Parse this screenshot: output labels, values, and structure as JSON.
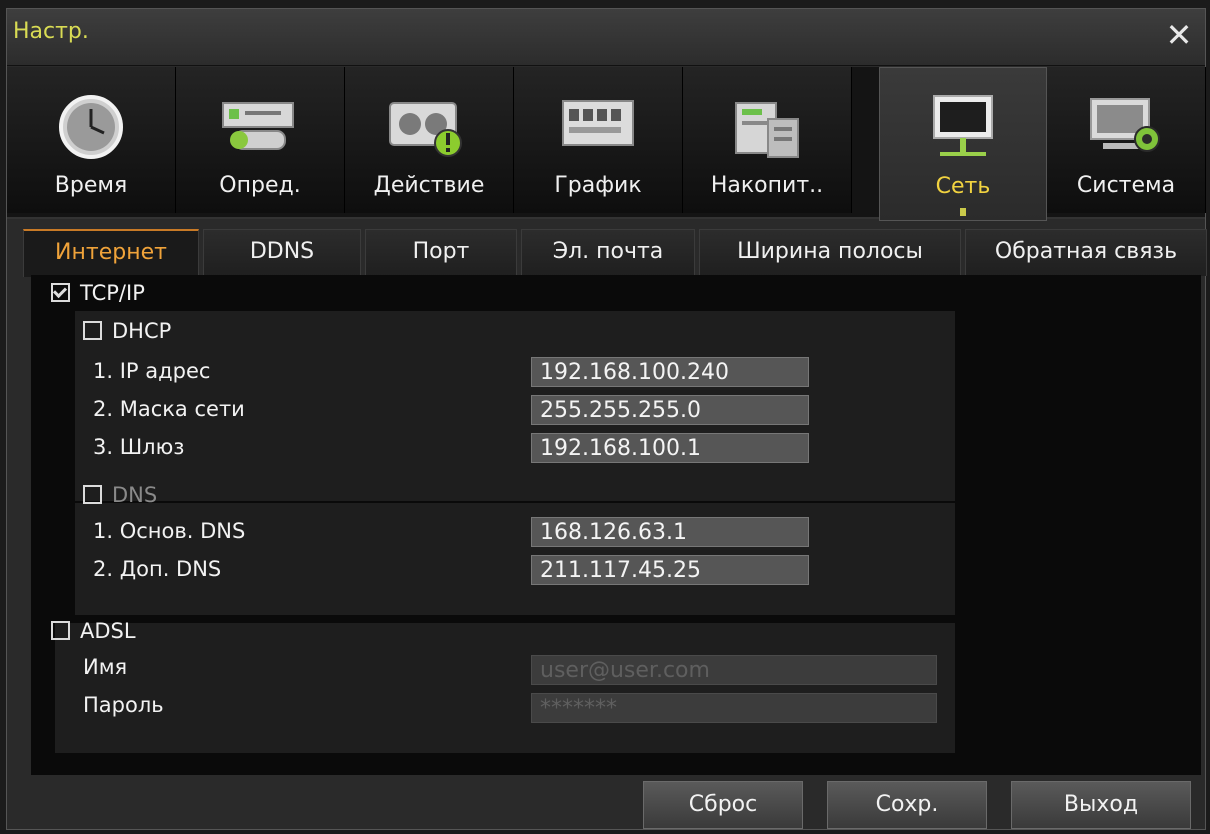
{
  "window": {
    "title": "Настр."
  },
  "toolbar": {
    "items": [
      {
        "label": "Время"
      },
      {
        "label": "Опред."
      },
      {
        "label": "Действие"
      },
      {
        "label": "График"
      },
      {
        "label": "Накопит.."
      },
      {
        "label": "Сеть"
      },
      {
        "label": "Система"
      }
    ],
    "active": "Сеть"
  },
  "tabs": [
    {
      "label": "Интернет"
    },
    {
      "label": "DDNS"
    },
    {
      "label": "Порт"
    },
    {
      "label": "Эл. почта"
    },
    {
      "label": "Ширина полосы"
    },
    {
      "label": "Обратная связь"
    }
  ],
  "form": {
    "tcpip": {
      "label": "TCP/IP",
      "checked": true
    },
    "dhcp": {
      "label": "DHCP",
      "checked": false
    },
    "ip": {
      "label": "1. IP адрес",
      "value": "192.168.100.240"
    },
    "mask": {
      "label": "2. Маска сети",
      "value": "255.255.255.0"
    },
    "gateway": {
      "label": "3. Шлюз",
      "value": "192.168.100.1"
    },
    "dns": {
      "label": "DNS",
      "checked": false
    },
    "dns1": {
      "label": "1. Основ. DNS",
      "value": "168.126.63.1"
    },
    "dns2": {
      "label": "2. Доп. DNS",
      "value": "211.117.45.25"
    },
    "adsl": {
      "label": "ADSL",
      "checked": false
    },
    "name": {
      "label": "Имя",
      "value": "user@user.com"
    },
    "password": {
      "label": "Пароль",
      "value": "*******"
    }
  },
  "footer": {
    "reset": "Сброс",
    "save": "Сохр.",
    "exit": "Выход"
  },
  "colors": {
    "title": "#d9dc54",
    "active_tab": "#f0a33a",
    "active_tool": "#f2d340"
  }
}
